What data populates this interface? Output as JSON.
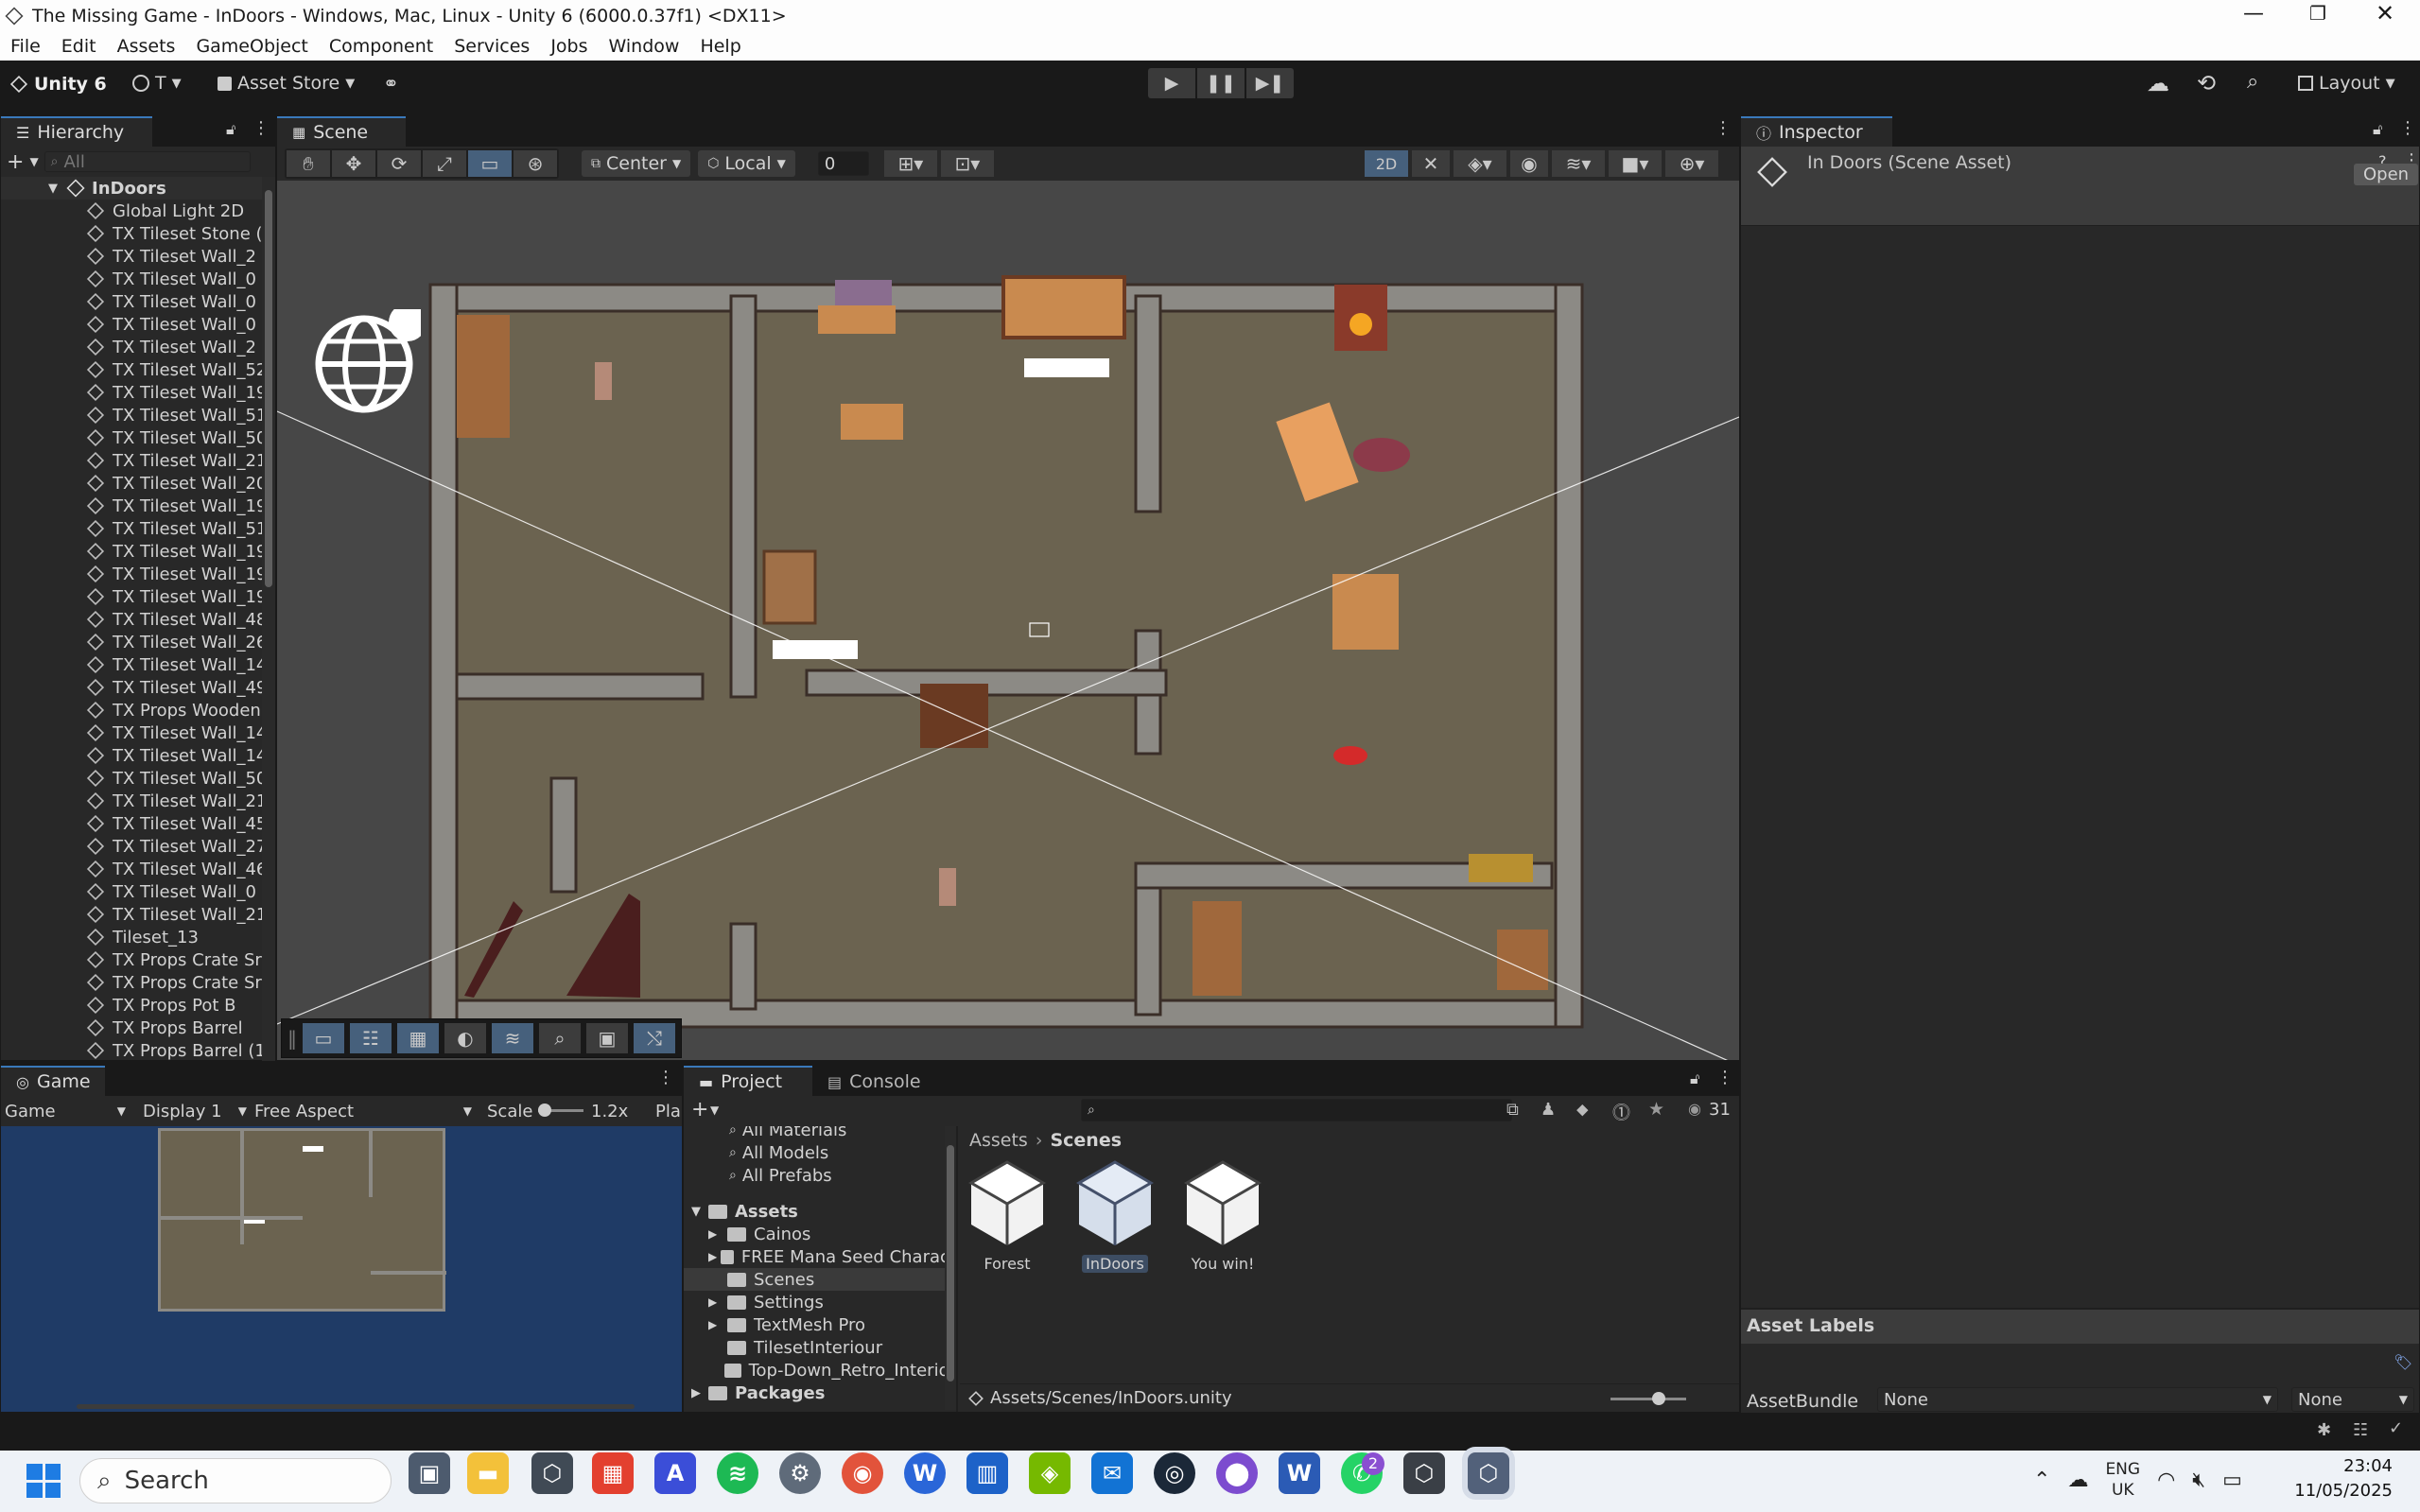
{
  "window": {
    "title": "The Missing Game - InDoors - Windows, Mac, Linux - Unity 6 (6000.0.37f1) <DX11>"
  },
  "menu": [
    "File",
    "Edit",
    "Assets",
    "GameObject",
    "Component",
    "Services",
    "Jobs",
    "Window",
    "Help"
  ],
  "toolbar": {
    "brand": "Unity 6",
    "account": "T",
    "asset_store": "Asset Store",
    "layout": "Layout"
  },
  "hierarchy": {
    "tab": "Hierarchy",
    "search_placeholder": "All",
    "scene": "InDoors",
    "items": [
      "Global Light 2D",
      "TX Tileset Stone (",
      "TX Tileset Wall_2",
      "TX Tileset Wall_0",
      "TX Tileset Wall_0 (",
      "TX Tileset Wall_0 (",
      "TX Tileset Wall_2",
      "TX Tileset Wall_52",
      "TX Tileset Wall_19",
      "TX Tileset Wall_51",
      "TX Tileset Wall_50",
      "TX Tileset Wall_21",
      "TX Tileset Wall_20",
      "TX Tileset Wall_19",
      "TX Tileset Wall_51",
      "TX Tileset Wall_19",
      "TX Tileset Wall_19",
      "TX Tileset Wall_19",
      "TX Tileset Wall_48",
      "TX Tileset Wall_26",
      "TX Tileset Wall_14",
      "TX Tileset Wall_49",
      "TX Props Wooden",
      "TX Tileset Wall_14",
      "TX Tileset Wall_14",
      "TX Tileset Wall_50",
      "TX Tileset Wall_21",
      "TX Tileset Wall_45",
      "TX Tileset Wall_27",
      "TX Tileset Wall_46",
      "TX Tileset Wall_0 (",
      "TX Tileset Wall_21",
      "Tileset_13",
      "TX Props Crate Sr",
      "TX Props Crate Sr",
      "TX Props Pot B",
      "TX Props Barrel",
      "TX Props Barrel (1"
    ]
  },
  "scene": {
    "tab": "Scene",
    "pivot": "Center",
    "space": "Local",
    "snap_value": "0",
    "mode_2d": "2D"
  },
  "inspector": {
    "tab": "Inspector",
    "title": "In Doors (Scene Asset)",
    "open": "Open",
    "asset_labels": "Asset Labels",
    "asset_bundle_label": "AssetBundle",
    "bundle_value": "None",
    "variant_value": "None"
  },
  "game": {
    "tab": "Game",
    "view": "Game",
    "display": "Display 1",
    "aspect": "Free Aspect",
    "scale_label": "Scale",
    "scale_value": "1.2x",
    "play_label": "Pla"
  },
  "project": {
    "tab": "Project",
    "console_tab": "Console",
    "count": "31",
    "favorites": [
      "All Materials",
      "All Models",
      "All Prefabs"
    ],
    "assets_root": "Assets",
    "folders": [
      "Cainos",
      "FREE Mana Seed Charact",
      "Scenes",
      "Settings",
      "TextMesh Pro",
      "TilesetInteriour",
      "Top-Down_Retro_Interior"
    ],
    "packages": "Packages",
    "breadcrumb_root": "Assets",
    "breadcrumb_current": "Scenes",
    "files": [
      "Forest",
      "InDoors",
      "You win!"
    ],
    "path": "Assets/Scenes/InDoors.unity"
  },
  "taskbar": {
    "search": "Search",
    "lang1": "ENG",
    "lang2": "UK",
    "time": "23:04",
    "date": "11/05/2025",
    "badge": "2"
  }
}
